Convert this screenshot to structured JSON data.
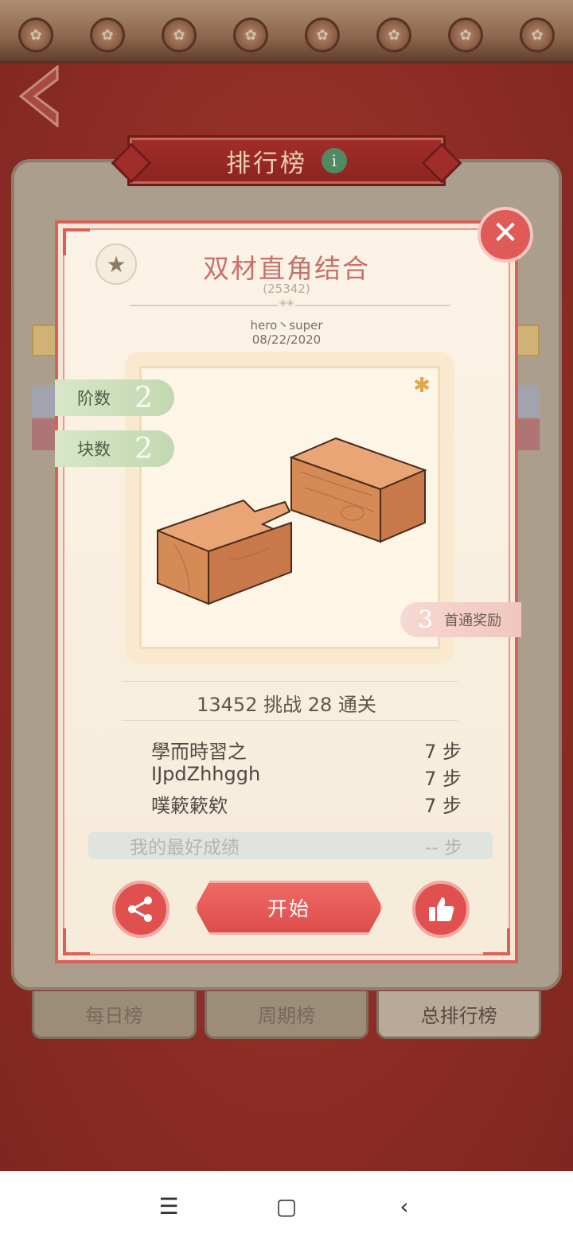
{
  "header": {
    "title": "排行榜",
    "info_icon": "i"
  },
  "tabs": [
    {
      "label": "每日榜",
      "active": false
    },
    {
      "label": "周期榜",
      "active": false
    },
    {
      "label": "总排行榜",
      "active": true
    }
  ],
  "puzzle": {
    "title": "双材直角结合",
    "id": "(25342)",
    "author": "hero丶super",
    "date": "08/22/2020",
    "level_label": "阶数",
    "level_value": "2",
    "pieces_label": "块数",
    "pieces_value": "2",
    "reward_value": "3",
    "reward_label": "首通奖励",
    "stats": "13452 挑战  28 通关"
  },
  "leaderboard": [
    {
      "name": "學而時習之",
      "steps": "7 步"
    },
    {
      "name": "IJpdZhhggh",
      "steps": "7 步"
    },
    {
      "name": "噗簌簌欸",
      "steps": "7 步"
    }
  ],
  "best": {
    "label": "我的最好成绩",
    "value": "-- 步"
  },
  "buttons": {
    "start": "开始"
  },
  "colors": {
    "accent": "#e0504f",
    "background": "#a1322c",
    "panel": "#f8eede"
  }
}
